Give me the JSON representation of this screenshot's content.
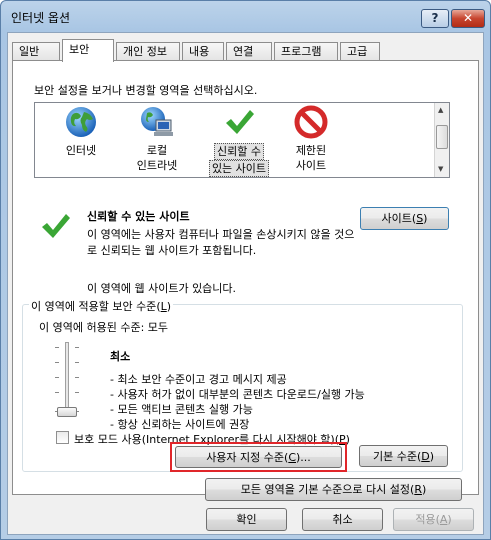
{
  "window": {
    "title": "인터넷 옵션",
    "help_glyph": "?",
    "close_glyph": "✕"
  },
  "tabs": [
    {
      "label": "일반"
    },
    {
      "label": "보안",
      "active": true
    },
    {
      "label": "개인 정보"
    },
    {
      "label": "내용"
    },
    {
      "label": "연결"
    },
    {
      "label": "프로그램"
    },
    {
      "label": "고급"
    }
  ],
  "security": {
    "instruction": "보안 설정을 보거나 변경할 영역을 선택하십시오.",
    "zones": [
      {
        "line1": "인터넷",
        "line2": "",
        "icon": "globe-icon"
      },
      {
        "line1": "로컬",
        "line2": "인트라넷",
        "icon": "intranet-icon"
      },
      {
        "line1": "신뢰할 수",
        "line2": "있는 사이트",
        "icon": "checkmark-icon",
        "selected": true
      },
      {
        "line1": "제한된",
        "line2": "사이트",
        "icon": "restricted-icon"
      }
    ],
    "selected_zone": {
      "title": "신뢰할 수 있는 사이트",
      "description": "이 영역에는 사용자 컴퓨터나 파일을 손상시키지 않을 것으로 신뢰되는 웹 사이트가 포함됩니다.",
      "status": "이 영역에 웹 사이트가 있습니다.",
      "sites_button": "사이트",
      "sites_key": "S"
    },
    "level_group": {
      "legend": "이 영역에 적용할 보안 수준",
      "legend_key": "L",
      "allowed": "이 영역에 허용된 수준: 모두",
      "level_name": "최소",
      "level_points": [
        "- 최소 보안 수준이고 경고 메시지 제공",
        "- 사용자 허가 없이 대부분의 콘텐츠 다운로드/실행 가능",
        "- 모든 액티브 콘텐츠 실행 가능",
        "- 항상 신뢰하는 사이트에 권장"
      ],
      "slider_level": 0
    },
    "protected_mode": {
      "label": "보호 모드 사용(Internet Explorer를 다시 시작해야 함)",
      "key": "P",
      "checked": false
    },
    "custom_level_button": "사용자 지정 수준",
    "custom_level_key": "C",
    "default_level_button": "기본 수준",
    "default_level_key": "D",
    "reset_all_button": "모든 영역을 기본 수준으로 다시 설정",
    "reset_all_key": "R"
  },
  "footer": {
    "ok": "확인",
    "cancel": "취소",
    "apply": "적용",
    "apply_key": "A"
  },
  "colors": {
    "highlight_border": "#e0262a",
    "check_green": "#3aa635",
    "restricted_red": "#d42a2a"
  }
}
